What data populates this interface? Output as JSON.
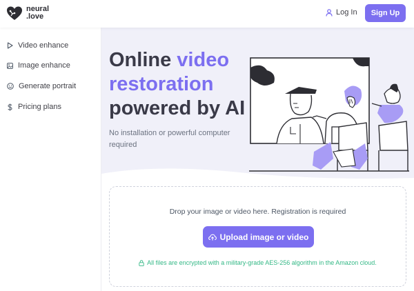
{
  "brand": {
    "name_line1": "neural",
    "name_line2": ".love",
    "accent_color": "#7c6ff0",
    "success_color": "#34b886"
  },
  "header": {
    "login_label": "Log In",
    "login_icon": "user-icon",
    "signup_label": "Sign Up"
  },
  "sidebar": {
    "items": [
      {
        "label": "Video enhance",
        "icon": "play-icon"
      },
      {
        "label": "Image enhance",
        "icon": "image-icon"
      },
      {
        "label": "Generate portrait",
        "icon": "smile-icon"
      },
      {
        "label": "Pricing plans",
        "icon": "dollar-icon"
      }
    ]
  },
  "hero": {
    "title_part1": "Online",
    "title_accent": "video restoration",
    "title_part2": "powered by AI",
    "subtitle": "No installation or powerful computer required"
  },
  "upload": {
    "drop_text": "Drop your image or video here. Registration is required",
    "button_label": "Upload image or video",
    "button_icon": "cloud-upload-icon",
    "security_icon": "lock-icon",
    "security_text": "All files are encrypted with a military-grade AES-256 algorithm in the Amazon cloud."
  }
}
